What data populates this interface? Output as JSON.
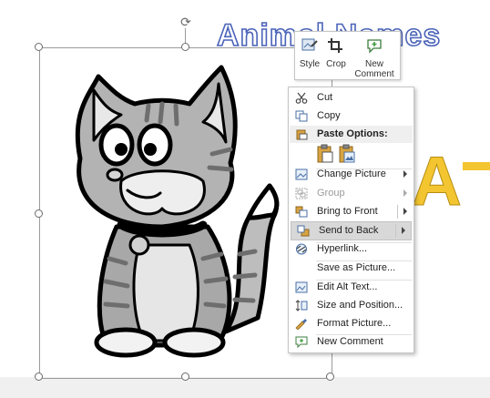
{
  "slide": {
    "title_text": "Animal Names",
    "side_letter": "A"
  },
  "mini_toolbar": {
    "style_label": "Style",
    "crop_label": "Crop",
    "new_comment_label_1": "New",
    "new_comment_label_2": "Comment"
  },
  "context_menu": {
    "items": [
      {
        "label": "Cut",
        "icon": "scissors-icon"
      },
      {
        "label": "Copy",
        "icon": "copy-icon"
      },
      {
        "label": "Paste Options:",
        "icon": "clipboard-icon"
      },
      {
        "label": "Change Picture",
        "icon": "change-picture-icon",
        "submenu": true
      },
      {
        "label": "Group",
        "icon": "group-icon",
        "submenu": true,
        "disabled": true
      },
      {
        "label": "Bring to Front",
        "icon": "bring-to-front-icon",
        "submenu": true
      },
      {
        "label": "Send to Back",
        "icon": "send-to-back-icon",
        "submenu": true,
        "highlighted": true
      },
      {
        "label": "Hyperlink...",
        "icon": "hyperlink-icon"
      },
      {
        "label": "Save as Picture...",
        "icon": ""
      },
      {
        "label": "Edit Alt Text...",
        "icon": "alt-text-icon"
      },
      {
        "label": "Size and Position...",
        "icon": "size-position-icon"
      },
      {
        "label": "Format Picture...",
        "icon": "format-picture-icon"
      },
      {
        "label": "New Comment",
        "icon": "new-comment-icon"
      }
    ]
  },
  "colors": {
    "title_outline": "#4a63b8",
    "side_letter": "#f3c530",
    "menu_highlight": "#d8d8d8",
    "selection_frame": "#9a9a9a"
  }
}
